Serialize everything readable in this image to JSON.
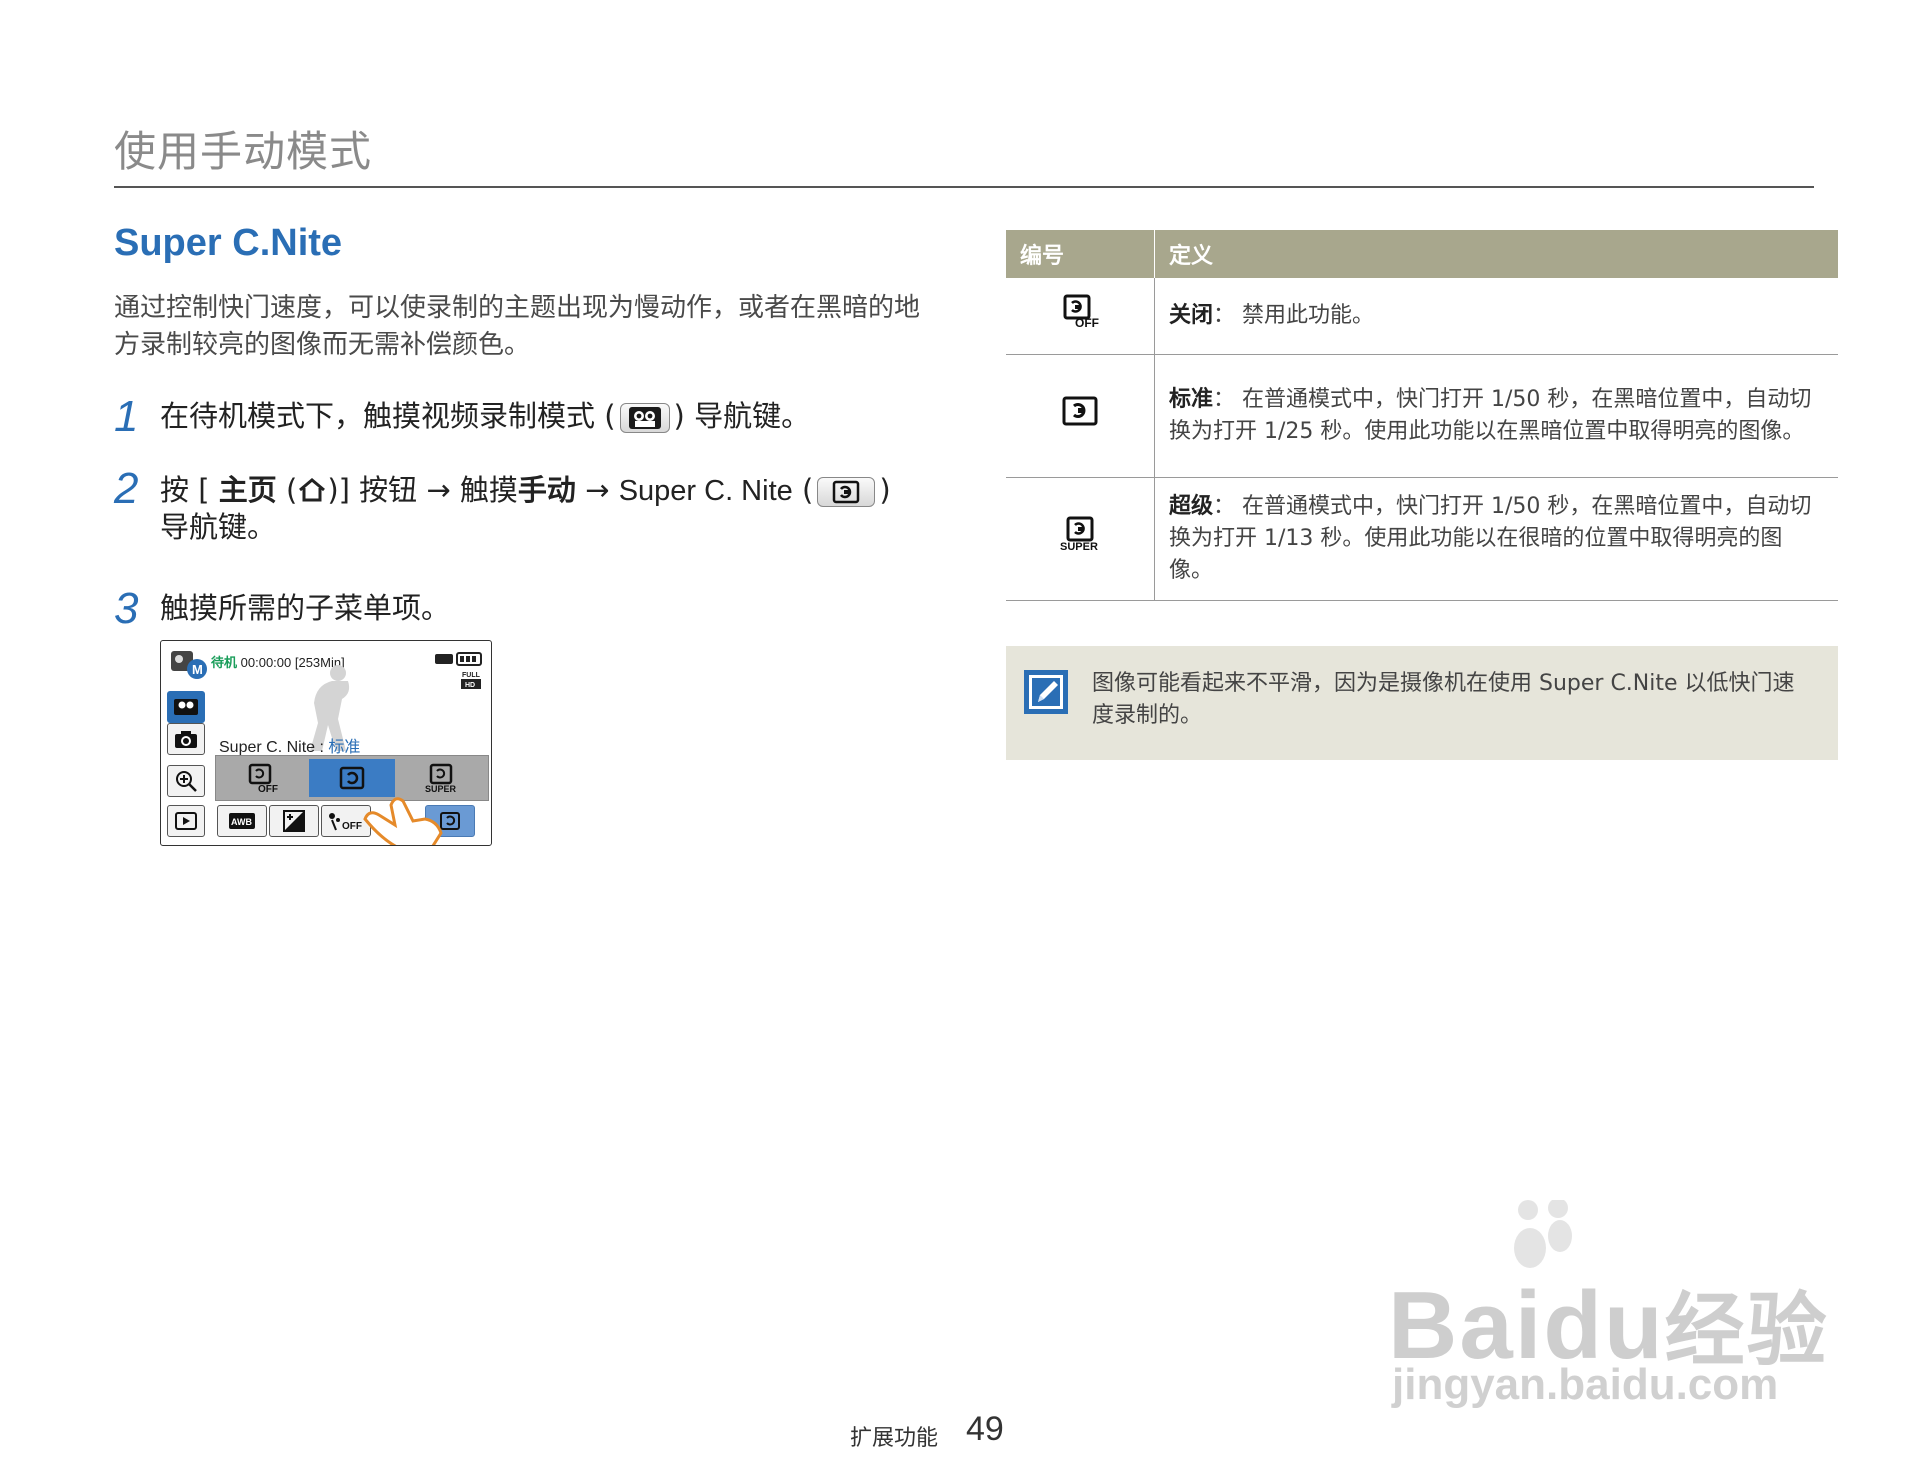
{
  "header": {
    "title": "使用手动模式"
  },
  "section": {
    "title": "Super C.Nite",
    "intro": "通过控制快门速度，可以使录制的主题出现为慢动作，或者在黑暗的地方录制较亮的图像而无需补偿颜色。"
  },
  "steps": [
    {
      "num": "1",
      "pre": "在待机模式下，触摸视频录制模式 (",
      "post": ") 导航键。"
    },
    {
      "num": "2",
      "t1": "按 [ ",
      "t2": "主页",
      "t3": " (",
      "t4": ")] 按钮 → 触摸",
      "t5": "手动",
      "t6": " → ",
      "t7": "Super C. Nite",
      "t8": " (",
      "t9": ")",
      "t10": "导航键。"
    },
    {
      "num": "3",
      "text": "触摸所需的子菜单项。"
    }
  ],
  "screen": {
    "status_mode": "待机",
    "status_time": "00:00:00 [253Min]",
    "setting_label": "Super C. Nite : ",
    "setting_value": "标准",
    "icon_names": [
      "camcorder-manual-icon",
      "video-mode-icon",
      "photo-mode-icon",
      "zoom-icon",
      "playback-icon",
      "awb-icon",
      "exposure-icon",
      "nite-off-icon",
      "finger-touch-icon"
    ]
  },
  "table": {
    "headers": [
      "编号",
      "定义"
    ],
    "rows": [
      {
        "icon": "nite-off-icon",
        "term": "关闭",
        "sep": "：",
        "desc": "禁用此功能。"
      },
      {
        "icon": "nite-normal-icon",
        "term": "标准",
        "sep": "：",
        "desc": "在普通模式中，快门打开 1/50 秒，在黑暗位置中，自动切换为打开 1/25 秒。使用此功能以在黑暗位置中取得明亮的图像。"
      },
      {
        "icon": "nite-super-icon",
        "term": "超级",
        "sep": "：",
        "desc": "在普通模式中，快门打开 1/50 秒，在黑暗位置中，自动切换为打开 1/13 秒。使用此功能以在很暗的位置中取得明亮的图像。"
      }
    ]
  },
  "note": {
    "icon": "note-pencil-icon",
    "text": "图像可能看起来不平滑，因为是摄像机在使用 Super C.Nite 以低快门速度录制的。"
  },
  "footer": {
    "section": "扩展功能",
    "page": "49"
  },
  "watermark": {
    "brand": "Bai",
    "brand2": "du",
    "brand3": "经验",
    "url": "jingyan.baidu.com"
  },
  "colors": {
    "accent": "#2a6eb5",
    "table_header": "#a8a78d",
    "note_bg": "#e6e5da"
  }
}
